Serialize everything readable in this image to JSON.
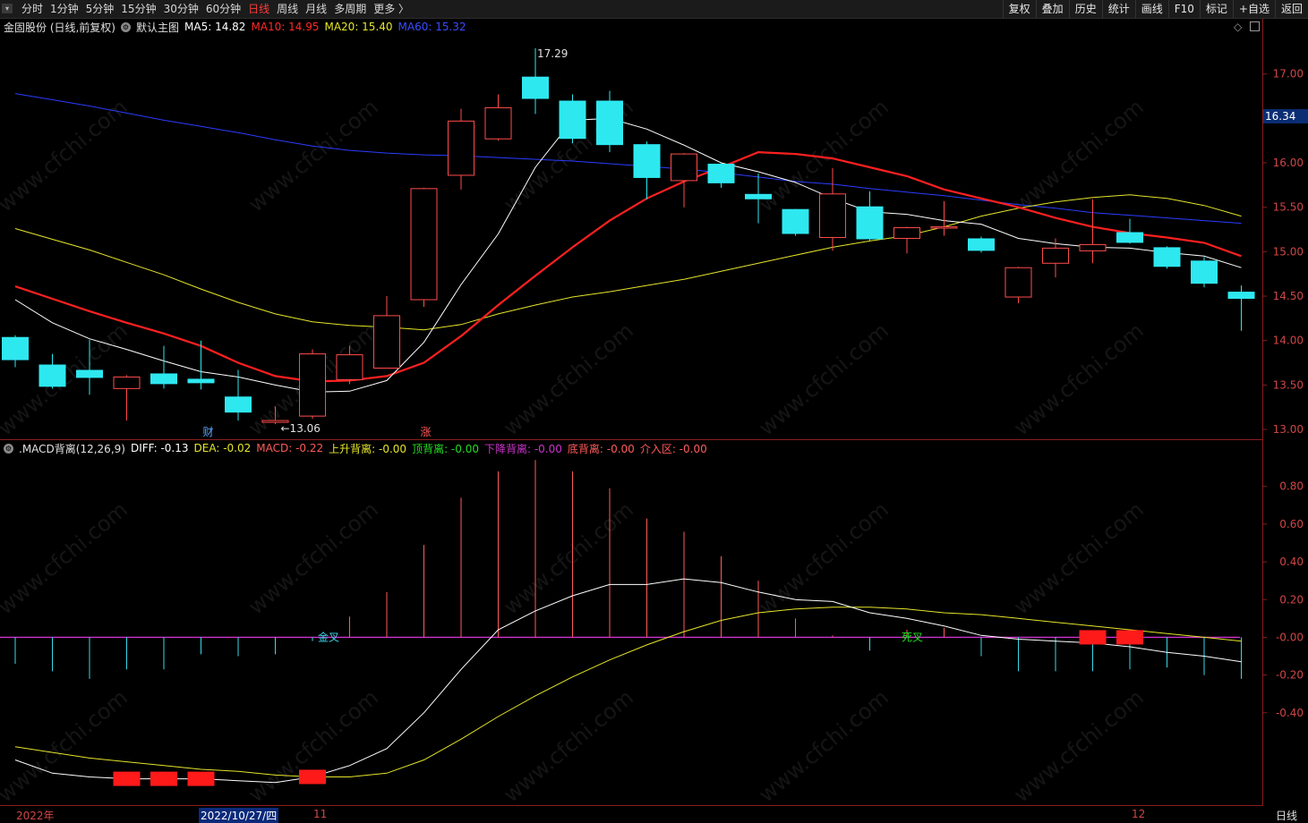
{
  "toolbar": {
    "periods": [
      "分时",
      "1分钟",
      "5分钟",
      "15分钟",
      "30分钟",
      "60分钟",
      "日线",
      "周线",
      "月线",
      "多周期",
      "更多 〉"
    ],
    "active_period": "日线",
    "tools": [
      "复权",
      "叠加",
      "历史",
      "统计",
      "画线",
      "F10",
      "标记",
      "+自选",
      "返回"
    ]
  },
  "main_legend": {
    "stock": "金固股份 (日线,前复权)",
    "template": "默认主图",
    "ma5": "MA5: 14.82",
    "ma10": "MA10: 14.95",
    "ma20": "MA20: 15.40",
    "ma60": "MA60: 15.32"
  },
  "sub_legend": {
    "name": ".MACD背离(12,26,9)",
    "diff": "DIFF: -0.13",
    "dea": "DEA: -0.02",
    "macd": "MACD: -0.22",
    "up_div": "上升背离: -0.00",
    "top_div": "顶背离: -0.00",
    "down_div": "下降背离: -0.00",
    "bottom_div": "底背离: -0.00",
    "entry": "介入区: -0.00"
  },
  "colors": {
    "up": "#ff4b4b",
    "down": "#2ee8f0",
    "ma5": "#ffffff",
    "ma10": "#ff2020",
    "ma20": "#e5e52a",
    "ma60": "#2a3cff",
    "axis": "#8b1d1d",
    "macd_up": "#ff5a5a",
    "macd_down": "#3ad8e8",
    "purple": "#cc33cc"
  },
  "current_price": "16.34",
  "annotations": {
    "high": "17.29",
    "low": "←13.06",
    "marker_cai": "财",
    "marker_zhang": "涨",
    "gold_cross": "金叉",
    "dead_cross": "死叉"
  },
  "dates": {
    "year": "2022年",
    "selected": "2022/10/27/四",
    "m11": "11",
    "m12": "12"
  },
  "timeframe": "日线",
  "chart_data": [
    {
      "type": "candlestick",
      "title": "金固股份 (日线,前复权)",
      "ylim": [
        12.95,
        17.45
      ],
      "y_ticks": [
        "17.00",
        "16.50",
        "16.00",
        "15.50",
        "15.00",
        "14.50",
        "14.00",
        "13.50",
        "13.00"
      ],
      "candles": [
        {
          "o": 14.04,
          "h": 14.06,
          "l": 13.7,
          "c": 13.78
        },
        {
          "o": 13.73,
          "h": 13.85,
          "l": 13.46,
          "c": 13.48
        },
        {
          "o": 13.67,
          "h": 14.01,
          "l": 13.39,
          "c": 13.58
        },
        {
          "o": 13.46,
          "h": 13.61,
          "l": 13.1,
          "c": 13.59
        },
        {
          "o": 13.63,
          "h": 13.94,
          "l": 13.46,
          "c": 13.51
        },
        {
          "o": 13.57,
          "h": 14.0,
          "l": 13.45,
          "c": 13.52
        },
        {
          "o": 13.37,
          "h": 13.67,
          "l": 13.1,
          "c": 13.19
        },
        {
          "o": 13.08,
          "h": 13.26,
          "l": 13.06,
          "c": 13.1
        },
        {
          "o": 13.15,
          "h": 13.9,
          "l": 13.12,
          "c": 13.85
        },
        {
          "o": 13.56,
          "h": 13.94,
          "l": 13.51,
          "c": 13.84
        },
        {
          "o": 13.69,
          "h": 14.5,
          "l": 13.69,
          "c": 14.28
        },
        {
          "o": 14.46,
          "h": 15.72,
          "l": 14.38,
          "c": 15.71
        },
        {
          "o": 15.86,
          "h": 16.61,
          "l": 15.7,
          "c": 16.47
        },
        {
          "o": 16.27,
          "h": 16.77,
          "l": 16.25,
          "c": 16.62
        },
        {
          "o": 16.97,
          "h": 17.29,
          "l": 16.55,
          "c": 16.72
        },
        {
          "o": 16.7,
          "h": 16.77,
          "l": 16.22,
          "c": 16.27
        },
        {
          "o": 16.7,
          "h": 16.81,
          "l": 16.12,
          "c": 16.2
        },
        {
          "o": 16.21,
          "h": 16.24,
          "l": 15.59,
          "c": 15.83
        },
        {
          "o": 15.8,
          "h": 16.11,
          "l": 15.5,
          "c": 16.1
        },
        {
          "o": 15.99,
          "h": 16.01,
          "l": 15.72,
          "c": 15.77
        },
        {
          "o": 15.65,
          "h": 15.88,
          "l": 15.32,
          "c": 15.59
        },
        {
          "o": 15.48,
          "h": 15.48,
          "l": 15.18,
          "c": 15.2
        },
        {
          "o": 15.16,
          "h": 15.94,
          "l": 15.01,
          "c": 15.65
        },
        {
          "o": 15.51,
          "h": 15.68,
          "l": 15.12,
          "c": 15.14
        },
        {
          "o": 15.15,
          "h": 15.28,
          "l": 14.98,
          "c": 15.27
        },
        {
          "o": 15.27,
          "h": 15.57,
          "l": 15.18,
          "c": 15.28
        },
        {
          "o": 15.15,
          "h": 15.17,
          "l": 14.99,
          "c": 15.01
        },
        {
          "o": 14.49,
          "h": 14.83,
          "l": 14.42,
          "c": 14.82
        },
        {
          "o": 14.87,
          "h": 15.15,
          "l": 14.71,
          "c": 15.04
        },
        {
          "o": 15.01,
          "h": 15.59,
          "l": 14.87,
          "c": 15.08
        },
        {
          "o": 15.22,
          "h": 15.37,
          "l": 15.09,
          "c": 15.1
        },
        {
          "o": 15.05,
          "h": 15.06,
          "l": 14.81,
          "c": 14.83
        },
        {
          "o": 14.9,
          "h": 14.94,
          "l": 14.6,
          "c": 14.64
        },
        {
          "o": 14.55,
          "h": 14.62,
          "l": 14.11,
          "c": 14.47
        }
      ],
      "ma5": [
        14.46,
        14.2,
        14.02,
        13.9,
        13.77,
        13.65,
        13.59,
        13.5,
        13.42,
        13.43,
        13.55,
        13.98,
        14.63,
        15.2,
        15.95,
        16.48,
        16.5,
        16.38,
        16.2,
        16.0,
        15.9,
        15.78,
        15.6,
        15.45,
        15.42,
        15.35,
        15.31,
        15.15,
        15.09,
        15.05,
        15.04,
        14.99,
        14.95,
        14.82
      ],
      "ma10": [
        14.61,
        14.47,
        14.33,
        14.2,
        14.08,
        13.94,
        13.75,
        13.6,
        13.54,
        13.55,
        13.6,
        13.75,
        14.05,
        14.4,
        14.73,
        15.05,
        15.35,
        15.6,
        15.79,
        15.95,
        16.12,
        16.1,
        16.05,
        15.95,
        15.85,
        15.7,
        15.6,
        15.5,
        15.38,
        15.28,
        15.21,
        15.16,
        15.1,
        14.95
      ],
      "ma20": [
        15.26,
        15.14,
        15.02,
        14.88,
        14.74,
        14.58,
        14.43,
        14.3,
        14.21,
        14.17,
        14.15,
        14.12,
        14.18,
        14.3,
        14.4,
        14.49,
        14.55,
        14.62,
        14.69,
        14.78,
        14.87,
        14.96,
        15.05,
        15.12,
        15.18,
        15.28,
        15.4,
        15.49,
        15.56,
        15.61,
        15.64,
        15.6,
        15.52,
        15.4
      ],
      "ma60": [
        16.78,
        16.71,
        16.64,
        16.56,
        16.48,
        16.41,
        16.34,
        16.26,
        16.19,
        16.14,
        16.11,
        16.09,
        16.08,
        16.06,
        16.04,
        16.02,
        15.99,
        15.96,
        15.93,
        15.89,
        15.84,
        15.79,
        15.76,
        15.71,
        15.67,
        15.63,
        15.58,
        15.53,
        15.49,
        15.44,
        15.41,
        15.38,
        15.35,
        15.32
      ]
    },
    {
      "type": "bar",
      "title": ".MACD背离(12,26,9)",
      "ylim": [
        -0.88,
        0.96
      ],
      "y_ticks": [
        "0.80",
        "0.60",
        "0.40",
        "0.20",
        "-0.00",
        "-0.20",
        "-0.40"
      ],
      "macd": [
        -0.14,
        -0.18,
        -0.22,
        -0.17,
        -0.17,
        -0.09,
        -0.1,
        -0.09,
        -0.02,
        0.11,
        0.24,
        0.49,
        0.74,
        0.88,
        0.94,
        0.88,
        0.79,
        0.63,
        0.56,
        0.43,
        0.3,
        0.1,
        0.01,
        -0.07,
        0.04,
        0.05,
        -0.1,
        -0.18,
        -0.18,
        -0.18,
        -0.17,
        -0.16,
        -0.2,
        -0.22
      ],
      "diff": [
        -0.65,
        -0.72,
        -0.74,
        -0.75,
        -0.75,
        -0.75,
        -0.76,
        -0.77,
        -0.74,
        -0.68,
        -0.59,
        -0.4,
        -0.17,
        0.04,
        0.14,
        0.22,
        0.28,
        0.28,
        0.31,
        0.29,
        0.24,
        0.2,
        0.19,
        0.13,
        0.1,
        0.06,
        0.01,
        -0.01,
        -0.02,
        -0.03,
        -0.05,
        -0.08,
        -0.1,
        -0.13
      ],
      "dea": [
        -0.58,
        -0.61,
        -0.64,
        -0.66,
        -0.68,
        -0.7,
        -0.71,
        -0.73,
        -0.74,
        -0.74,
        -0.72,
        -0.65,
        -0.54,
        -0.42,
        -0.31,
        -0.21,
        -0.12,
        -0.04,
        0.03,
        0.09,
        0.13,
        0.15,
        0.16,
        0.16,
        0.15,
        0.13,
        0.12,
        0.1,
        0.08,
        0.06,
        0.04,
        0.02,
        0.0,
        -0.02
      ]
    }
  ]
}
